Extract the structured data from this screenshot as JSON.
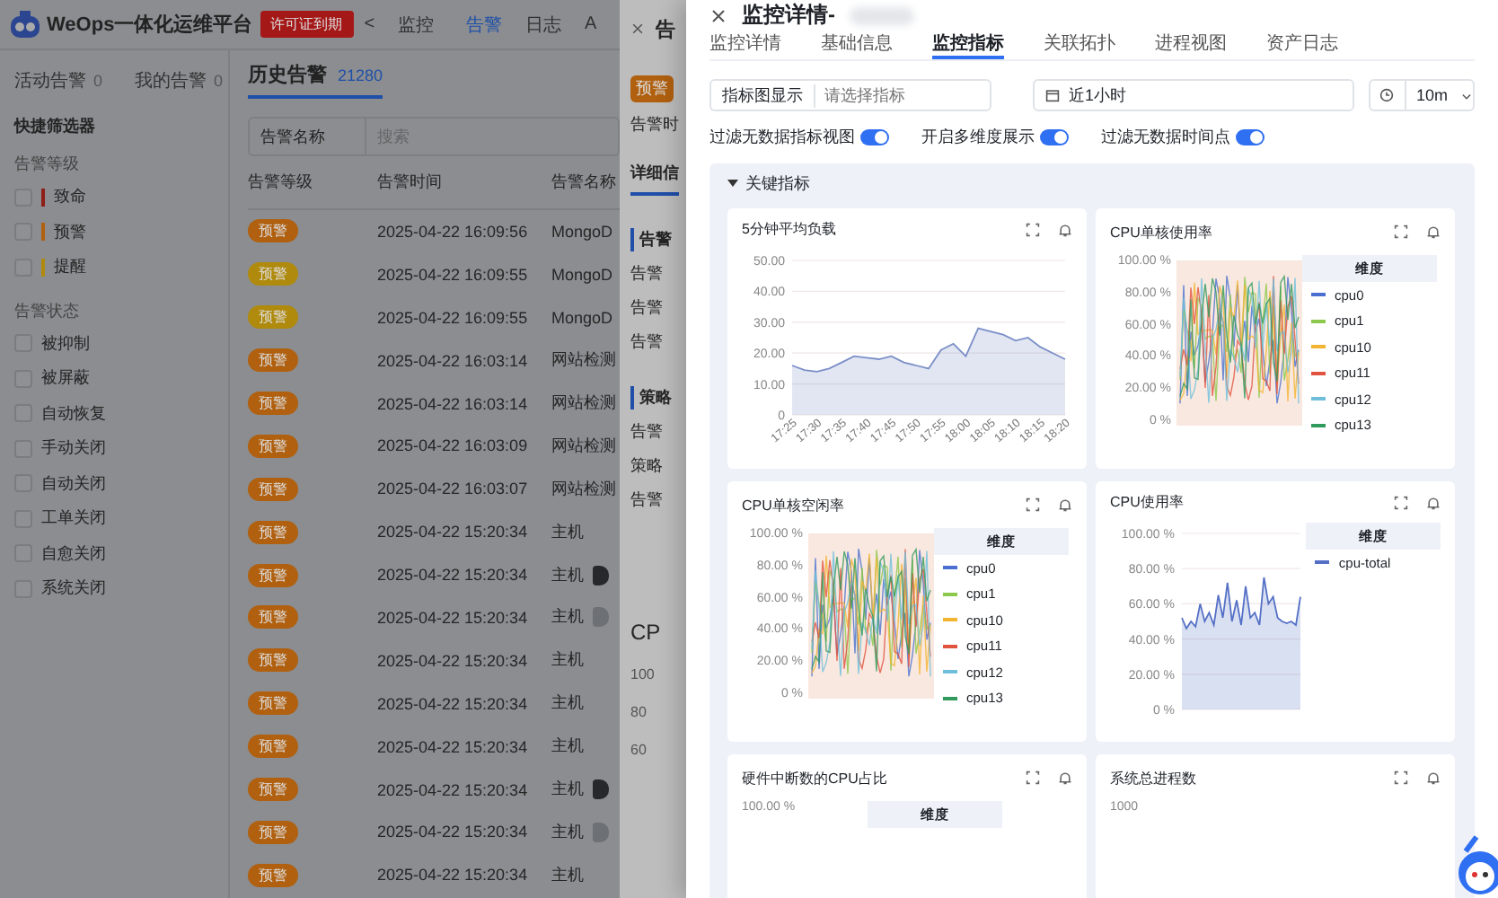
{
  "background_page": {
    "header": {
      "app_title": "WeOps一体化运维平台",
      "license_badge": "许可证到期",
      "back": "<",
      "nav": [
        {
          "label": "监控",
          "selected": false
        },
        {
          "label": "告警",
          "selected": true
        },
        {
          "label": "日志",
          "selected": false
        },
        {
          "label": "A",
          "selected": false
        }
      ]
    },
    "sidebar": {
      "tabs": [
        {
          "label": "活动告警",
          "count": "0",
          "selected": false
        },
        {
          "label": "我的告警",
          "count": "0",
          "selected": false
        }
      ],
      "filter_title": "快捷筛选器",
      "groups": [
        {
          "title": "告警等级",
          "options": [
            {
              "label": "致命",
              "color": "#8f1d18",
              "checked": false
            },
            {
              "label": "预警",
              "color": "#b0600f",
              "checked": false
            },
            {
              "label": "提醒",
              "color": "#b08a0c",
              "checked": false
            }
          ]
        },
        {
          "title": "告警状态",
          "options": [
            {
              "label": "被抑制",
              "checked": false
            },
            {
              "label": "被屏蔽",
              "checked": false
            },
            {
              "label": "自动恢复",
              "checked": false
            },
            {
              "label": "手动关闭",
              "checked": false
            },
            {
              "label": "自动关闭",
              "checked": false
            },
            {
              "label": "工单关闭",
              "checked": false
            },
            {
              "label": "自愈关闭",
              "checked": false
            },
            {
              "label": "系统关闭",
              "checked": false
            }
          ]
        }
      ]
    },
    "history_tab": {
      "label": "历史告警",
      "count": "21280",
      "selected": true
    },
    "filter": {
      "field": "告警名称",
      "placeholder": "搜索"
    },
    "table": {
      "columns": [
        "告警等级",
        "告警时间",
        "告警名称"
      ],
      "rows": [
        {
          "level": "预警",
          "color": "#b0600f",
          "time": "2025-04-22 16:09:56",
          "name": "MongoD"
        },
        {
          "level": "预警",
          "color": "#b08a0c",
          "time": "2025-04-22 16:09:55",
          "name": "MongoD"
        },
        {
          "level": "预警",
          "color": "#b08a0c",
          "time": "2025-04-22 16:09:55",
          "name": "MongoD"
        },
        {
          "level": "预警",
          "color": "#b0600f",
          "time": "2025-04-22 16:03:14",
          "name": "网站检测"
        },
        {
          "level": "预警",
          "color": "#b0600f",
          "time": "2025-04-22 16:03:14",
          "name": "网站检测"
        },
        {
          "level": "预警",
          "color": "#b0600f",
          "time": "2025-04-22 16:03:09",
          "name": "网站检测"
        },
        {
          "level": "预警",
          "color": "#b0600f",
          "time": "2025-04-22 16:03:07",
          "name": "网站检测"
        },
        {
          "level": "预警",
          "color": "#b0600f",
          "time": "2025-04-22 15:20:34",
          "name": "主机"
        },
        {
          "level": "预警",
          "color": "#b0600f",
          "time": "2025-04-22 15:20:34",
          "name": "主机",
          "tag": {
            "color": "#26282c"
          }
        },
        {
          "level": "预警",
          "color": "#b0600f",
          "time": "2025-04-22 15:20:34",
          "name": "主机",
          "tag": {
            "color": "#6d7074"
          }
        },
        {
          "level": "预警",
          "color": "#b0600f",
          "time": "2025-04-22 15:20:34",
          "name": "主机"
        },
        {
          "level": "预警",
          "color": "#b0600f",
          "time": "2025-04-22 15:20:34",
          "name": "主机"
        },
        {
          "level": "预警",
          "color": "#b0600f",
          "time": "2025-04-22 15:20:34",
          "name": "主机"
        },
        {
          "level": "预警",
          "color": "#b0600f",
          "time": "2025-04-22 15:20:34",
          "name": "主机",
          "tag": {
            "color": "#26282c"
          }
        },
        {
          "level": "预警",
          "color": "#b0600f",
          "time": "2025-04-22 15:20:34",
          "name": "主机",
          "tag": {
            "color": "#6d7074"
          }
        },
        {
          "level": "预警",
          "color": "#b0600f",
          "time": "2025-04-22 15:20:34",
          "name": "主机"
        }
      ]
    }
  },
  "alert_drawer": {
    "title": "告",
    "items": [
      {
        "kind": "badge",
        "text": "预警"
      },
      {
        "kind": "text",
        "text": "告警时"
      },
      {
        "kind": "tab",
        "text": "详细信"
      },
      {
        "kind": "heading",
        "text": "告警"
      },
      {
        "kind": "text",
        "text": "告警"
      },
      {
        "kind": "text",
        "text": "告警"
      },
      {
        "kind": "text",
        "text": "告警"
      },
      {
        "kind": "heading",
        "text": "策略"
      },
      {
        "kind": "text",
        "text": "告警"
      },
      {
        "kind": "text",
        "text": "策略"
      },
      {
        "kind": "text",
        "text": "告警"
      },
      {
        "kind": "big",
        "text": "CP"
      },
      {
        "kind": "axis",
        "text": "100"
      },
      {
        "kind": "axis",
        "text": "80"
      },
      {
        "kind": "axis",
        "text": "60"
      }
    ]
  },
  "monitor_drawer": {
    "title": "监控详情-",
    "tabs": [
      {
        "label": "监控详情",
        "selected": false
      },
      {
        "label": "基础信息",
        "selected": false
      },
      {
        "label": "监控指标",
        "selected": true
      },
      {
        "label": "关联拓扑",
        "selected": false
      },
      {
        "label": "进程视图",
        "selected": false
      },
      {
        "label": "资产日志",
        "selected": false
      }
    ],
    "metric_filter": {
      "label": "指标图显示",
      "placeholder": "请选择指标"
    },
    "time_range": "近1小时",
    "refresh_interval": "10m",
    "toggles": [
      {
        "label": "过滤无数据指标视图",
        "on": true
      },
      {
        "label": "开启多维度展示",
        "on": true
      },
      {
        "label": "过滤无数据时间点",
        "on": true
      }
    ],
    "section": {
      "title": "关键指标",
      "expanded": true,
      "charts": [
        {
          "kind": "area",
          "title": "5分钟平均负载",
          "chart_data": {
            "type": "area",
            "grid": true,
            "categories": [
              "17:25",
              null,
              "17:30",
              null,
              "17:35",
              null,
              "17:40",
              null,
              "17:45",
              null,
              "17:50",
              null,
              "17:55",
              null,
              "18:00",
              null,
              "18:05",
              null,
              "18:10",
              null,
              "18:15",
              null,
              "18:20"
            ],
            "values": [
              16,
              14.5,
              14,
              15,
              17,
              19,
              18.5,
              18,
              19,
              17,
              16,
              15,
              21,
              23,
              19,
              28,
              27,
              26,
              24,
              25,
              22,
              20,
              18
            ],
            "ylim": [
              0,
              50
            ],
            "yticks": [
              {
                "value": 0,
                "label": "0"
              },
              {
                "value": 10,
                "label": "10.00"
              },
              {
                "value": 20,
                "label": "20.00"
              },
              {
                "value": 30,
                "label": "30.00"
              },
              {
                "value": 40,
                "label": "40.00"
              },
              {
                "value": 50,
                "label": "50.00"
              }
            ]
          }
        },
        {
          "kind": "multi",
          "title": "CPU单核使用率",
          "y_labels": [
            "100.00 %",
            "80.00 %",
            "60.00 %",
            "40.00 %",
            "20.00 %",
            "0 %"
          ],
          "legend_title": "维度",
          "legend": [
            {
              "name": "cpu0",
              "color": "#4a6fd0"
            },
            {
              "name": "cpu1",
              "color": "#8cc84b"
            },
            {
              "name": "cpu10",
              "color": "#f2b431"
            },
            {
              "name": "cpu11",
              "color": "#e0533f"
            },
            {
              "name": "cpu12",
              "color": "#6fbfdc"
            },
            {
              "name": "cpu13",
              "color": "#2f9a5c"
            }
          ]
        },
        {
          "kind": "multi",
          "title": "CPU单核空闲率",
          "y_labels": [
            "100.00 %",
            "80.00 %",
            "60.00 %",
            "40.00 %",
            "20.00 %",
            "0 %"
          ],
          "legend_title": "维度",
          "legend": [
            {
              "name": "cpu0",
              "color": "#4a6fd0"
            },
            {
              "name": "cpu1",
              "color": "#8cc84b"
            },
            {
              "name": "cpu10",
              "color": "#f2b431"
            },
            {
              "name": "cpu11",
              "color": "#e0533f"
            },
            {
              "name": "cpu12",
              "color": "#6fbfdc"
            },
            {
              "name": "cpu13",
              "color": "#2f9a5c"
            }
          ]
        },
        {
          "kind": "area",
          "title": "CPU使用率",
          "legend_title": "维度",
          "chart_data": {
            "type": "area",
            "grid": true,
            "series": [
              {
                "name": "cpu-total",
                "color": "#5470c6",
                "values": [
                  52,
                  46,
                  50,
                  47,
                  60,
                  50,
                  55,
                  48,
                  65,
                  52,
                  72,
                  50,
                  62,
                  48,
                  70,
                  52,
                  55,
                  48,
                  75,
                  60,
                  64,
                  52,
                  50,
                  49,
                  50,
                  48,
                  64
                ]
              }
            ],
            "ylim": [
              0,
              100
            ],
            "yticks": [
              {
                "value": 0,
                "label": "0 %"
              },
              {
                "value": 20,
                "label": "20.00 %"
              },
              {
                "value": 40,
                "label": "40.00 %"
              },
              {
                "value": 60,
                "label": "60.00 %"
              },
              {
                "value": 80,
                "label": "80.00 %"
              },
              {
                "value": 100,
                "label": "100.00 %"
              }
            ]
          }
        },
        {
          "kind": "stub",
          "title": "硬件中断数的CPU占比",
          "y_labels": [
            "100.00 %"
          ],
          "legend_title": "维度"
        },
        {
          "kind": "stub",
          "title": "系统总进程数",
          "y_labels": [
            "1000"
          ]
        }
      ]
    }
  }
}
